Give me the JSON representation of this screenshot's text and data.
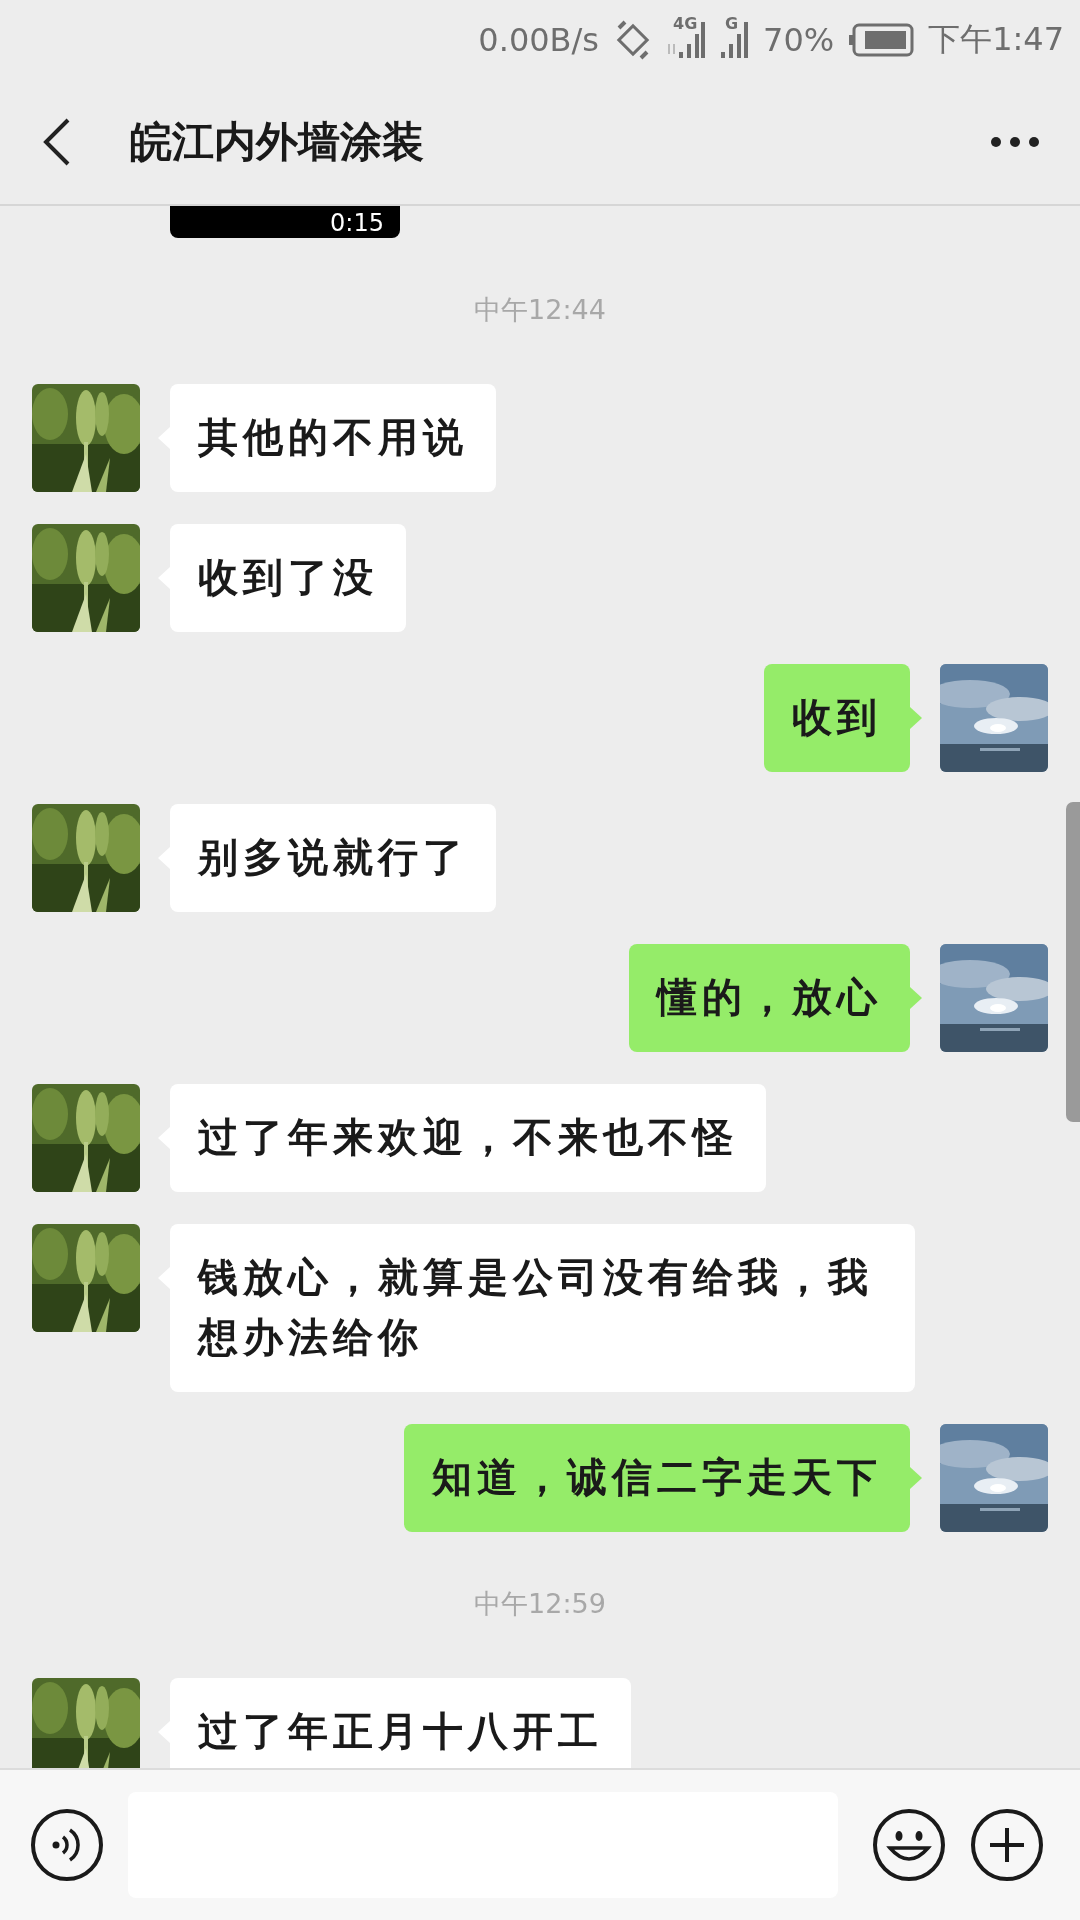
{
  "status_bar": {
    "net_speed": "0.00B/s",
    "network": "4G",
    "signal_2": "G",
    "battery": "70%",
    "time": "下午1:47"
  },
  "header": {
    "title": "皖江内外墙涂装"
  },
  "messages": [
    {
      "kind": "video",
      "duration": "0:15"
    },
    {
      "kind": "time",
      "text": "中午12:44"
    },
    {
      "kind": "text",
      "outgoing": false,
      "text": "其他的不用说"
    },
    {
      "kind": "text",
      "outgoing": false,
      "text": "收到了没"
    },
    {
      "kind": "text",
      "outgoing": true,
      "text": "收到"
    },
    {
      "kind": "text",
      "outgoing": false,
      "text": "别多说就行了"
    },
    {
      "kind": "text",
      "outgoing": true,
      "text": "懂的，放心"
    },
    {
      "kind": "text",
      "outgoing": false,
      "text": "过了年来欢迎，不来也不怪"
    },
    {
      "kind": "text",
      "outgoing": false,
      "text": "钱放心，就算是公司没有给我，我想办法给你"
    },
    {
      "kind": "text",
      "outgoing": true,
      "text": "知道，诚信二字走天下"
    },
    {
      "kind": "time",
      "text": "中午12:59"
    },
    {
      "kind": "text",
      "outgoing": false,
      "text": "过了年正月十八开工"
    }
  ]
}
